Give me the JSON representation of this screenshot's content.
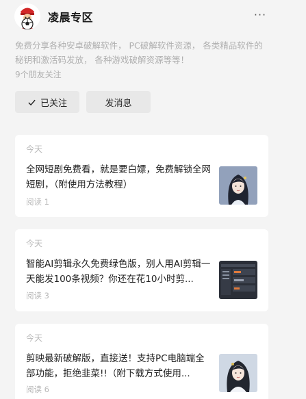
{
  "account": {
    "name": "凌晨专区",
    "intro": "免费分享各种安卓破解软件， PC破解软件资源， 各类精品软件的秘钥和激活码发放， 各种游戏破解资源等等！",
    "friends_following": "9个朋友关注",
    "more_label": "···"
  },
  "actions": {
    "follow_label": "已关注",
    "message_label": "发消息"
  },
  "articles": [
    {
      "date": "今天",
      "title": "全网短剧免费看，就是要白嫖，免费解锁全网短剧，（附使用方法教程）",
      "reads": "阅读 1",
      "thumb": "portrait"
    },
    {
      "date": "今天",
      "title": "智能AI剪辑永久免费绿色版，别人用AI剪辑一天能发100条视频？你还在花10小时剪...",
      "reads": "阅读 3",
      "thumb": "app-ui"
    },
    {
      "date": "今天",
      "title": "剪映最新破解版，直接送！支持PC电脑端全部功能，拒绝韭菜!!（附下载方式使用...",
      "reads": "阅读 6",
      "thumb": "portrait"
    }
  ]
}
